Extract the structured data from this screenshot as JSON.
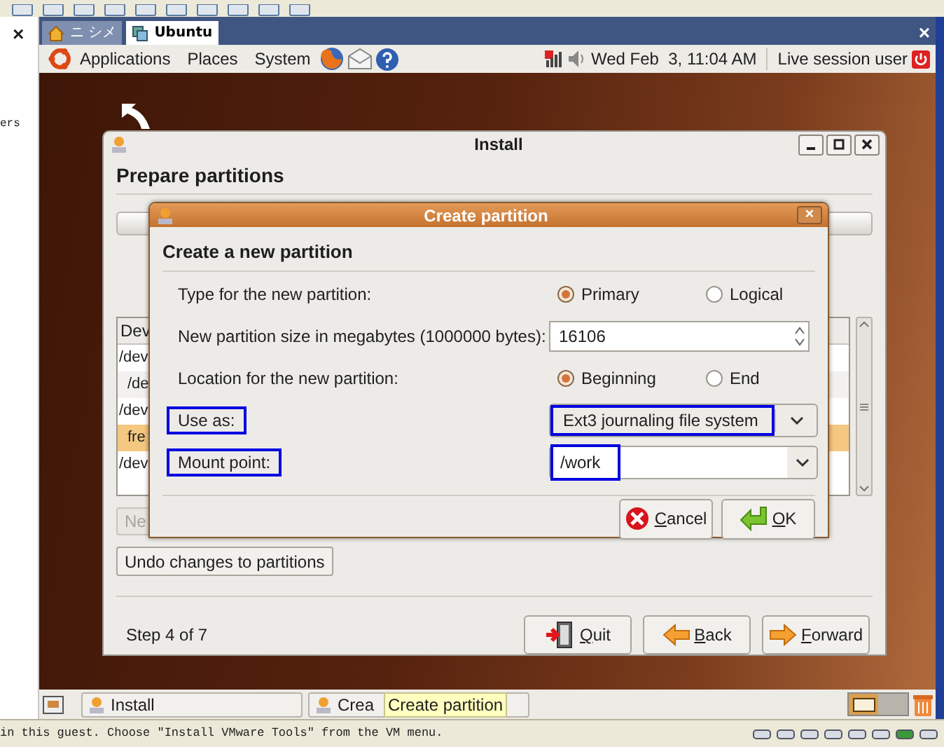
{
  "host_sidebar": {
    "close": "×",
    "text": "ers"
  },
  "vm_tabs": [
    {
      "label": "ニ シメ",
      "selected": false
    },
    {
      "label": "Ubuntu",
      "selected": true
    }
  ],
  "vm_close": "×",
  "top_panel": {
    "menus": [
      "Applications",
      "Places",
      "System"
    ],
    "clock": "Wed Feb  3, 11:04 AM",
    "user": "Live session user"
  },
  "install_window": {
    "title": "Install",
    "heading": "Prepare partitions",
    "table": {
      "header": "Dev",
      "rows": [
        {
          "text": "/dev",
          "selected": false
        },
        {
          "text": "/de",
          "selected": false
        },
        {
          "text": "/dev",
          "selected": false
        },
        {
          "text": "fre",
          "selected": true
        },
        {
          "text": "/dev",
          "selected": false
        }
      ]
    },
    "new_button": {
      "label": "Ne",
      "disabled": true
    },
    "undo_button": "Undo changes to partitions",
    "step": "Step 4 of 7",
    "buttons": [
      {
        "label": "Quit",
        "kind": "quit"
      },
      {
        "label": "Back",
        "kind": "back"
      },
      {
        "label": "Forward",
        "kind": "forward"
      }
    ]
  },
  "dialog": {
    "title": "Create partition",
    "close": "×",
    "heading": "Create a new partition",
    "rows": [
      {
        "kind": "radio",
        "label": "Type for the new partition:",
        "options": [
          {
            "label": "Primary",
            "selected": true
          },
          {
            "label": "Logical",
            "selected": false
          }
        ]
      },
      {
        "kind": "spin",
        "label": "New partition size in megabytes (1000000 bytes):",
        "value": "16106"
      },
      {
        "kind": "radio",
        "label": "Location for the new partition:",
        "options": [
          {
            "label": "Beginning",
            "selected": true
          },
          {
            "label": "End",
            "selected": false
          }
        ]
      },
      {
        "kind": "combo",
        "label": "Use as:",
        "value": "Ext3 journaling file system",
        "highlighted": true
      },
      {
        "kind": "combo_entry",
        "label": "Mount point:",
        "value": "/work",
        "highlighted": true
      }
    ],
    "buttons": [
      {
        "label": "Cancel",
        "kind": "cancel"
      },
      {
        "label": "OK",
        "kind": "ok"
      }
    ]
  },
  "taskbar": [
    {
      "label": "Install"
    },
    {
      "label": "Crea"
    }
  ],
  "tooltip": "Create partition",
  "status_bar": "in this guest. Choose \"Install VMware Tools\" from the VM menu."
}
